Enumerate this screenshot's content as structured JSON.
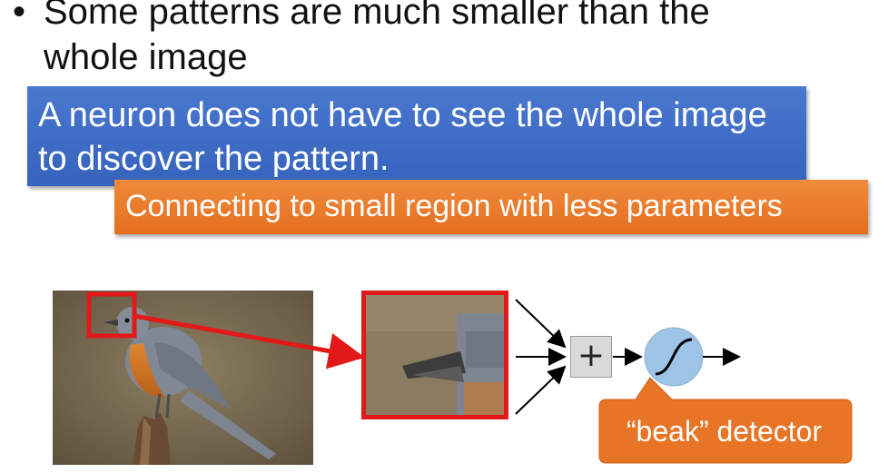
{
  "bullet": {
    "marker": "•",
    "text": "Some patterns are much smaller than the whole image"
  },
  "blue_note": {
    "line1": "A neuron does not have to see the whole image",
    "line2": "to discover the pattern."
  },
  "orange_note": "Connecting to small region with less parameters",
  "diagram": {
    "sum_symbol": "+",
    "detector_label": "“beak” detector"
  },
  "colors": {
    "blue_box": "#3e6dc6",
    "orange_box": "#e87425",
    "highlight_red": "#e11919",
    "neuron_fill": "#9dc3e6",
    "sum_box": "#d9d9d9"
  }
}
